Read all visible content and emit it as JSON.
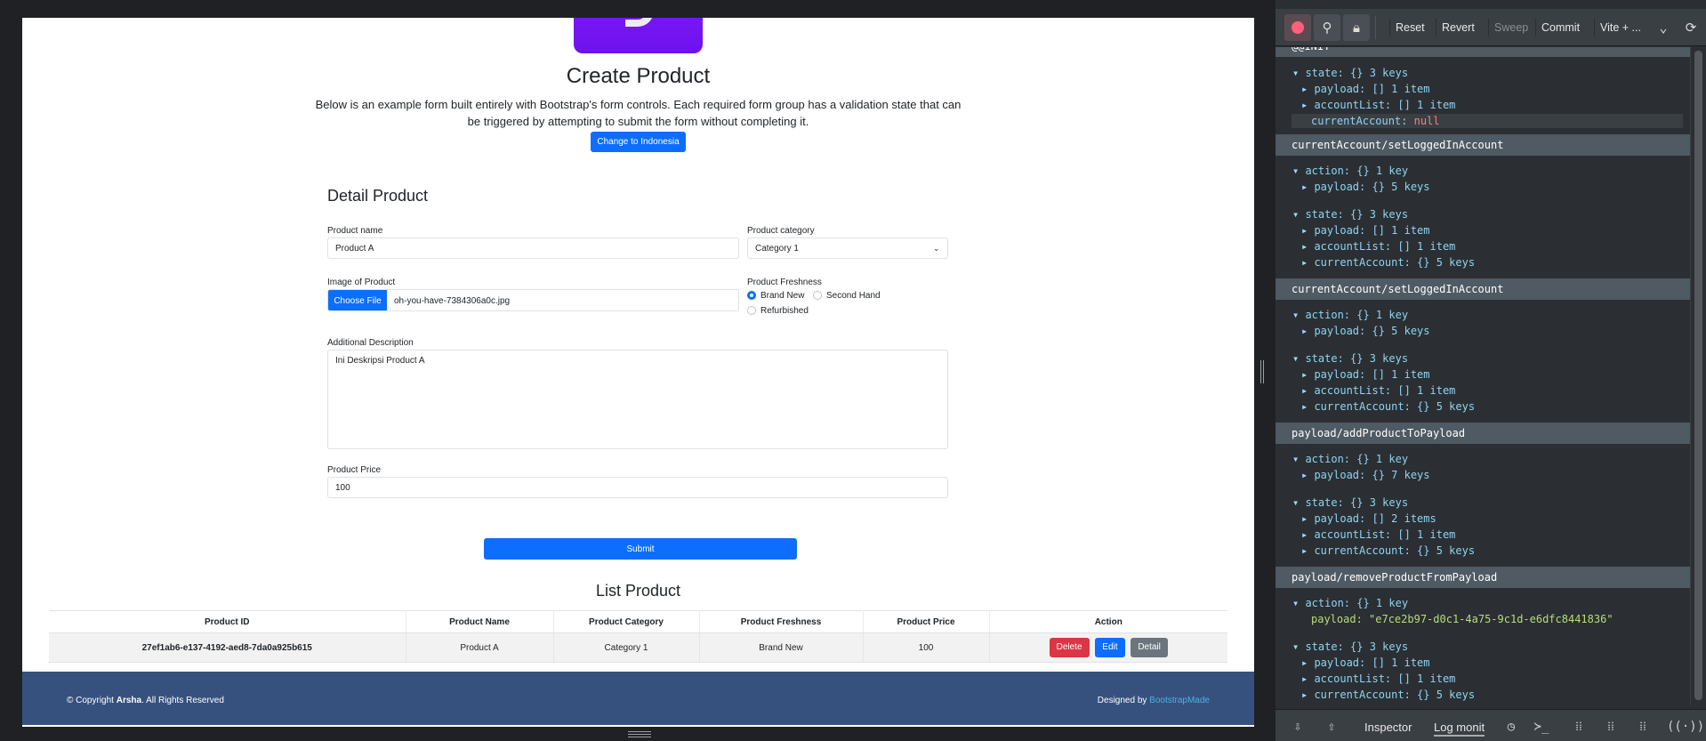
{
  "page": {
    "title": "Create Product",
    "lead_line1": "Below is an example form built entirely with Bootstrap's form controls. Each required form group has a validation state that can",
    "lead_line2": "be triggered by attempting to submit the form without completing it.",
    "lang_button": "Change to Indonesia"
  },
  "form": {
    "title": "Detail Product",
    "product_name_label": "Product name",
    "product_name_value": "Product A",
    "category_label": "Product category",
    "category_value": "Category 1",
    "image_label": "Image of Product",
    "choose_file": "Choose File",
    "file_name": "oh-you-have-7384306a0c.jpg",
    "freshness_label": "Product Freshness",
    "freshness_options": [
      "Brand New",
      "Second Hand",
      "Refurbished"
    ],
    "freshness_selected": "Brand New",
    "description_label": "Additional Description",
    "description_value": "Ini Deskripsi Product A",
    "price_label": "Product Price",
    "price_value": "100",
    "submit": "Submit"
  },
  "list": {
    "title": "List Product",
    "columns": [
      "Product ID",
      "Product Name",
      "Product Category",
      "Product Freshness",
      "Product Price",
      "Action"
    ],
    "rows": [
      {
        "id": "27ef1ab6-e137-4192-aed8-7da0a925b615",
        "name": "Product A",
        "category": "Category 1",
        "freshness": "Brand New",
        "price": "100"
      }
    ],
    "actions": {
      "delete": "Delete",
      "edit": "Edit",
      "detail": "Detail"
    }
  },
  "footer": {
    "copyright_prefix": "© Copyright ",
    "brand": "Arsha",
    "copyright_suffix": ". All Rights Reserved",
    "designed_by": "Designed by ",
    "designer": "BootstrapMade"
  },
  "devtools": {
    "toolbar": {
      "reset": "Reset",
      "revert": "Revert",
      "sweep": "Sweep",
      "commit": "Commit",
      "monitor_select": "Vite + ..."
    },
    "icons": [
      "record-icon",
      "pin-icon",
      "lock-icon",
      "chevron-down-icon",
      "refresh-icon"
    ],
    "bottom_tabs": {
      "inspector": "Inspector",
      "log_monitor": "Log monit"
    },
    "partial_header": "@@INIT",
    "init_state": {
      "state": "state: {} 3 keys",
      "payload": "payload: [] 1 item",
      "accountList": "accountList: [] 1 item",
      "currentAccount_key": "currentAccount: ",
      "currentAccount_val": "null"
    },
    "actions": [
      {
        "type": "currentAccount/setLoggedInAccount",
        "action_lines": [
          "action: {} 1 key",
          "payload: {} 5 keys"
        ],
        "state_lines": [
          "state: {} 3 keys",
          "payload: [] 1 item",
          "accountList: [] 1 item",
          "currentAccount: {} 5 keys"
        ]
      },
      {
        "type": "currentAccount/setLoggedInAccount",
        "action_lines": [
          "action: {} 1 key",
          "payload: {} 5 keys"
        ],
        "state_lines": [
          "state: {} 3 keys",
          "payload: [] 1 item",
          "accountList: [] 1 item",
          "currentAccount: {} 5 keys"
        ]
      },
      {
        "type": "payload/addProductToPayload",
        "action_lines": [
          "action: {} 1 key",
          "payload: {} 7 keys"
        ],
        "state_lines": [
          "state: {} 3 keys",
          "payload: [] 2 items",
          "accountList: [] 1 item",
          "currentAccount: {} 5 keys"
        ]
      },
      {
        "type": "payload/removeProductFromPayload",
        "action_lines": [
          "action: {} 1 key",
          "payload: \"e7ce2b97-d0c1-4a75-9c1d-e6dfc8441836\""
        ],
        "state_lines": [
          "state: {} 3 keys",
          "payload: [] 1 item",
          "accountList: [] 1 item",
          "currentAccount: {} 5 keys"
        ]
      }
    ]
  }
}
